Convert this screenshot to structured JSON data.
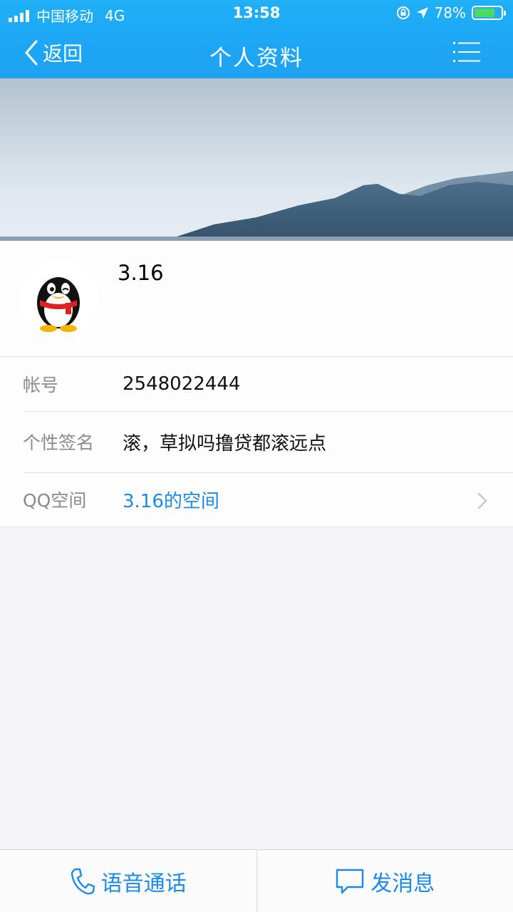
{
  "status_bar": {
    "carrier": "中国移动",
    "network": "4G",
    "time": "13:58",
    "battery_percent_label": "78%",
    "battery_level": 0.78,
    "icons": [
      "signal-icon",
      "orientation-lock-icon",
      "location-arrow-icon",
      "battery-charging-icon"
    ]
  },
  "nav": {
    "back_label": "返回",
    "title": "个人资料",
    "menu_icon": "menu-list-icon"
  },
  "profile": {
    "nickname": "3.16",
    "avatar_icon": "qq-penguin-avatar"
  },
  "info_rows": [
    {
      "label": "帐号",
      "value": "2548022444"
    },
    {
      "label": "个性签名",
      "value": "滚，草拟吗撸贷都滚远点"
    },
    {
      "label": "QQ空间",
      "value": "3.16的空间"
    }
  ],
  "bottom_bar": {
    "voice_call_label": "语音通话",
    "message_label": "发消息"
  },
  "colors": {
    "header": "#1da6f5",
    "link": "#1c8ae6",
    "background": "#f4f4f9"
  }
}
